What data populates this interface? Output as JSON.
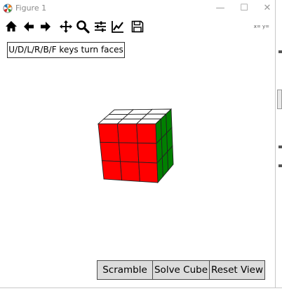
{
  "window": {
    "title": "Figure 1",
    "minimize_glyph": "—",
    "maximize_glyph": "☐",
    "close_glyph": "✕"
  },
  "toolbar": {
    "buttons": [
      {
        "icon": "home-icon"
      },
      {
        "icon": "back-arrow-icon"
      },
      {
        "icon": "forward-arrow-icon"
      },
      {
        "icon": "pan-icon"
      },
      {
        "icon": "zoom-icon"
      },
      {
        "icon": "subplots-config-icon"
      },
      {
        "icon": "edit-axis-icon"
      },
      {
        "icon": "save-icon"
      }
    ],
    "coords_text": "x= y="
  },
  "canvas": {
    "hint": "U/D/L/R/B/F keys turn faces",
    "cube": {
      "top_face": [
        "#ffffff",
        "#ffffff",
        "#ffffff",
        "#ffffff",
        "#ffffff",
        "#ffffff",
        "#ffffff",
        "#ffffff",
        "#ffffff"
      ],
      "front_face": [
        "#ff0000",
        "#ff0000",
        "#ff0000",
        "#ff0000",
        "#ff0000",
        "#ff0000",
        "#ff0000",
        "#ff0000",
        "#ff0000"
      ],
      "right_face": [
        "#008000",
        "#008000",
        "#008000",
        "#008000",
        "#008000",
        "#008000",
        "#008000",
        "#008000",
        "#008000"
      ]
    }
  },
  "buttons": {
    "scramble": "Scramble",
    "solve": "Solve Cube",
    "reset": "Reset View"
  },
  "colors": {
    "button_bg": "#dcdcdc",
    "button_border": "#4d4d4d",
    "cube_top": "#ffffff",
    "cube_front": "#ff0000",
    "cube_right": "#008000"
  }
}
